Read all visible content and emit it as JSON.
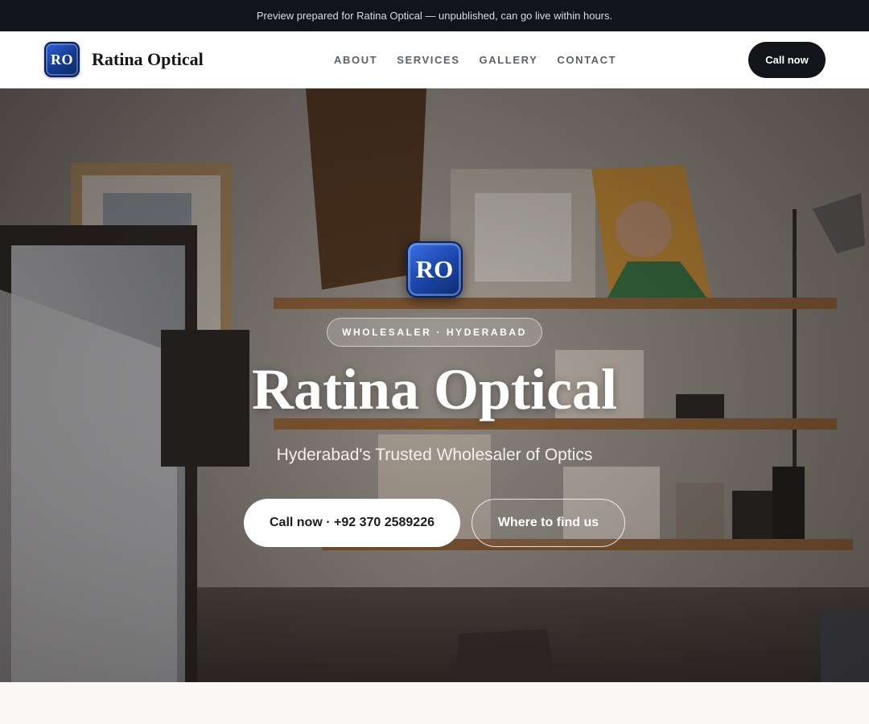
{
  "banner": {
    "text": "Preview prepared for Ratina Optical — unpublished, can go live within hours."
  },
  "nav": {
    "logo_initials": "RO",
    "brand_name": "Ratina Optical",
    "links": [
      "ABOUT",
      "SERVICES",
      "GALLERY",
      "CONTACT"
    ],
    "call_label": "Call now"
  },
  "hero": {
    "logo_initials": "RO",
    "tag": "WHOLESALER · HYDERABAD",
    "title": "Ratina Optical",
    "subtitle": "Hyderabad's Trusted Wholesaler of Optics",
    "primary_cta": "Call now · +92 370 2589226",
    "secondary_cta": "Where to find us"
  },
  "colors": {
    "banner_bg": "#11141b",
    "brand_blue": "#1a44a6",
    "cta_dark": "#13151b",
    "page_bg": "#faf9f5"
  }
}
